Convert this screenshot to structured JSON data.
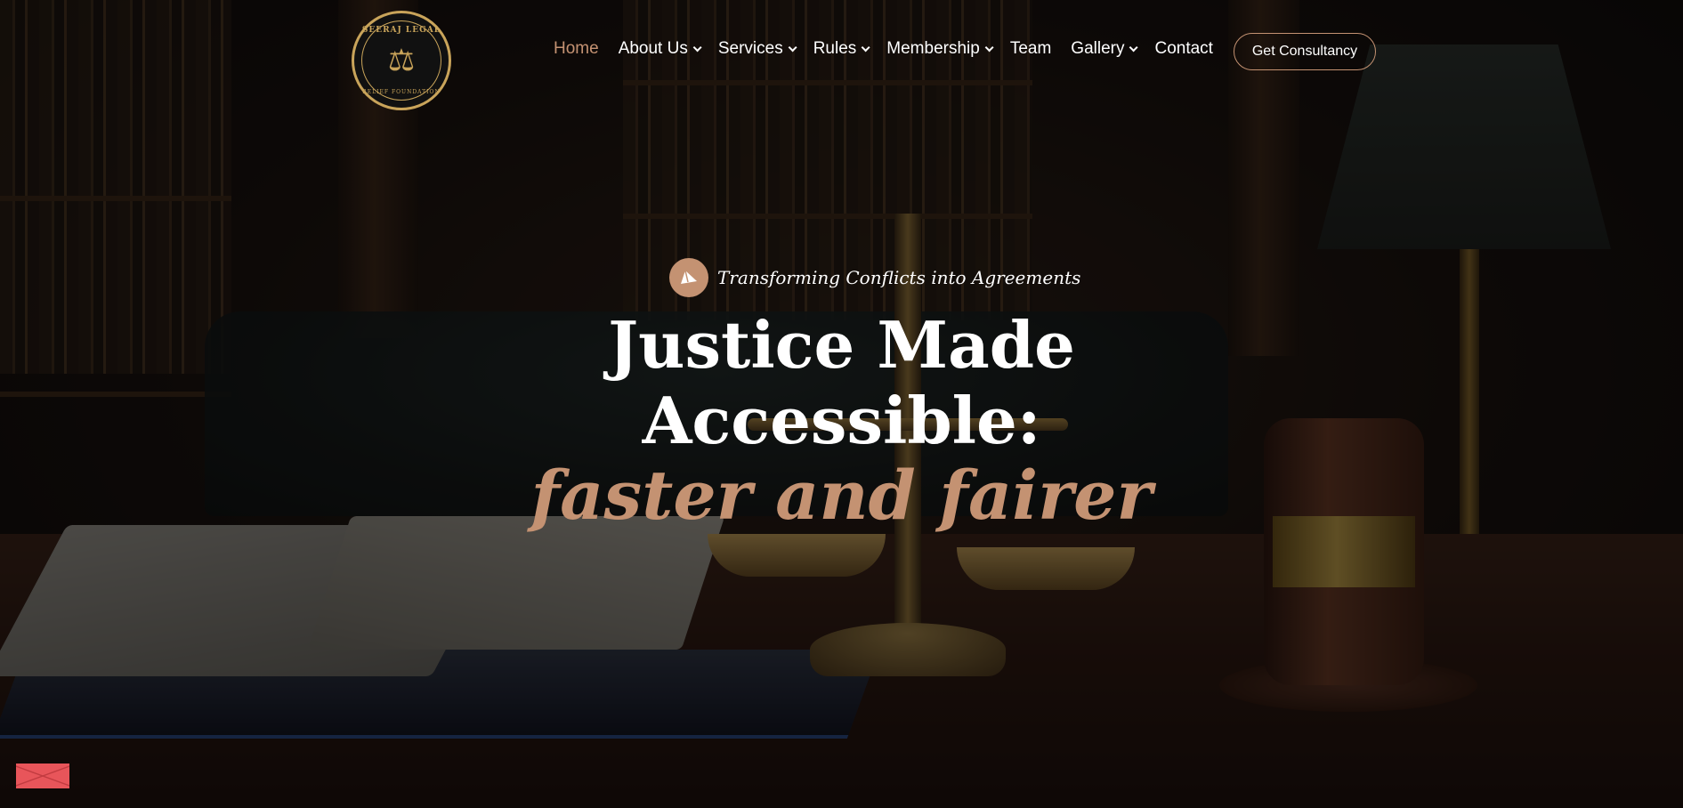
{
  "logo": {
    "text_top": "SEERAJ LEGAL",
    "text_bottom": "RELIEF FOUNDATION",
    "icon": "scales-of-justice-icon"
  },
  "nav": {
    "items": [
      {
        "label": "Home",
        "active": true,
        "has_dropdown": false
      },
      {
        "label": "About Us",
        "active": false,
        "has_dropdown": true
      },
      {
        "label": "Services",
        "active": false,
        "has_dropdown": true
      },
      {
        "label": "Rules",
        "active": false,
        "has_dropdown": true
      },
      {
        "label": "Membership",
        "active": false,
        "has_dropdown": true
      },
      {
        "label": "Team",
        "active": false,
        "has_dropdown": false
      },
      {
        "label": "Gallery",
        "active": false,
        "has_dropdown": true
      },
      {
        "label": "Contact",
        "active": false,
        "has_dropdown": false
      }
    ],
    "cta_label": "Get Consultancy"
  },
  "hero": {
    "tagline": "Transforming Conflicts into Agreements",
    "tagline_icon": "paper-plane-icon",
    "title_line1": "Justice Made",
    "title_line2": "Accessible:",
    "title_line3": "faster and fairer"
  },
  "floating": {
    "mail_icon": "envelope-icon"
  },
  "colors": {
    "accent": "#c49272",
    "gold": "#c9a45a",
    "mail_button": "#e8555a"
  }
}
